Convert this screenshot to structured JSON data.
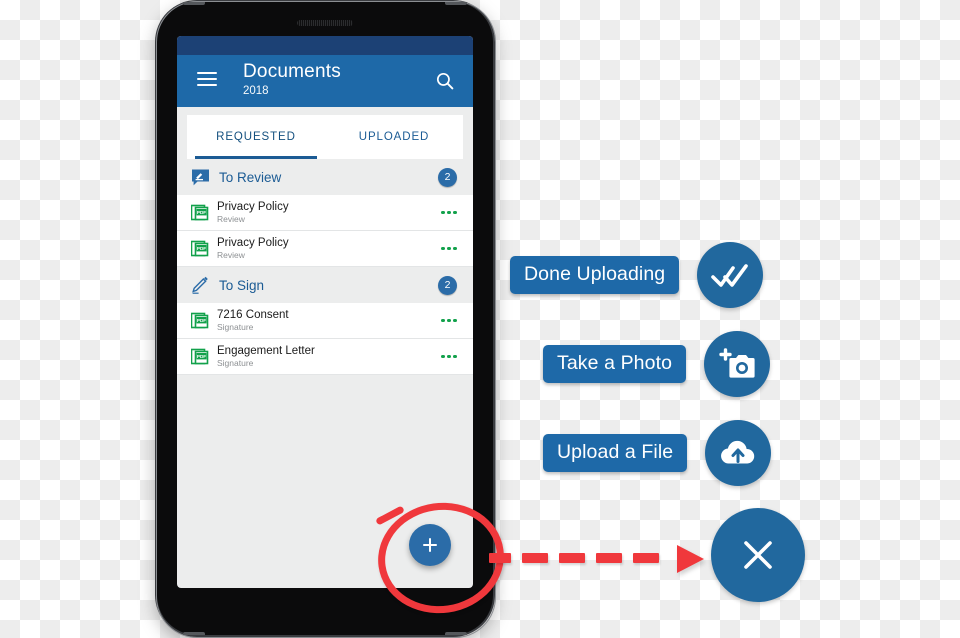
{
  "appbar": {
    "title": "Documents",
    "subtitle": "2018",
    "menu_icon": "hamburger-menu-icon",
    "search_icon": "search-icon"
  },
  "tabs": [
    {
      "label": "REQUESTED",
      "active": true
    },
    {
      "label": "UPLOADED",
      "active": false
    }
  ],
  "groups": [
    {
      "label": "To Review",
      "count": "2",
      "icon": "review-comment-icon",
      "items": [
        {
          "name": "Privacy Policy",
          "sub": "Review",
          "icon": "pdf-file-icon",
          "menu": "overflow-menu-icon"
        },
        {
          "name": "Privacy Policy",
          "sub": "Review",
          "icon": "pdf-file-icon",
          "menu": "overflow-menu-icon"
        }
      ]
    },
    {
      "label": "To Sign",
      "count": "2",
      "icon": "pencil-sign-icon",
      "items": [
        {
          "name": "7216 Consent",
          "sub": "Signature",
          "icon": "pdf-file-icon",
          "menu": "overflow-menu-icon"
        },
        {
          "name": "Engagement Letter",
          "sub": "Signature",
          "icon": "pdf-file-icon",
          "menu": "overflow-menu-icon"
        }
      ]
    }
  ],
  "fab": {
    "icon": "plus-icon"
  },
  "actions": [
    {
      "label": "Done Uploading",
      "icon": "double-check-icon"
    },
    {
      "label": "Take a Photo",
      "icon": "camera-add-icon"
    },
    {
      "label": "Upload a File",
      "icon": "cloud-upload-icon"
    },
    {
      "label": "",
      "icon": "close-x-icon"
    }
  ],
  "annotation": {
    "circle": "red-highlight-circle",
    "arrow": "red-dashed-arrow"
  },
  "colors": {
    "status_bar": "#1c4175",
    "app_bar": "#1e69a8",
    "accent_blue": "#21689e",
    "tab_active": "#1b5b94",
    "pdf_green": "#12a14b",
    "annotation_red": "#f0383c",
    "screen_bg": "#eceded"
  }
}
